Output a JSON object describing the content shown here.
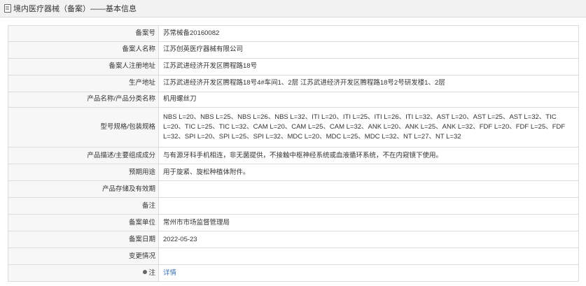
{
  "header": {
    "title": "境内医疗器械（备案）——基本信息"
  },
  "rows": [
    {
      "label": "备案号",
      "value": "苏常械备20160082"
    },
    {
      "label": "备案人名称",
      "value": "江苏创英医疗器械有限公司"
    },
    {
      "label": "备案人注册地址",
      "value": "江苏武进经济开发区腾程路18号"
    },
    {
      "label": "生产地址",
      "value": "江苏武进经济开发区腾程路18号4#车间1、2层 江苏武进经济开发区腾程路18号2号研发楼1、2层"
    },
    {
      "label": "产品名称/产品分类名称",
      "value": "机用螺丝刀"
    },
    {
      "label": "型号规格/包装规格",
      "value": "NBS L=20、NBS L=25、NBS L=26、NBS L=32、ITI L=20、ITI L=25、ITI L=26、ITI L=32、AST L=20、AST L=25、AST L=32、TIC L=20、TIC L=25、TIC L=32、CAM L=20、CAM L=25、CAM L=32、ANK L=20、ANK L=25、ANK L=32、FDF L=20、FDF L=25、FDF L=32、SPI L=20、SPI L=25、SPI L=32、MDC L=20、MDC L=25、MDC L=32、NT L=27、NT L=32"
    },
    {
      "label": "产品描述/主要组成成分",
      "value": "与有源牙科手机相连，非无菌提供，不接触中枢神经系统或血液循环系统，不在内窥镜下使用。"
    },
    {
      "label": "预期用途",
      "value": "用于旋紧、旋松种植体附件。"
    },
    {
      "label": "产品存储及有效期",
      "value": ""
    },
    {
      "label": "备注",
      "value": ""
    },
    {
      "label": "备案单位",
      "value": "常州市市场监督管理局"
    },
    {
      "label": "备案日期",
      "value": "2022-05-23"
    },
    {
      "label": "变更情况",
      "value": ""
    },
    {
      "label": "注",
      "value": "详情"
    }
  ]
}
